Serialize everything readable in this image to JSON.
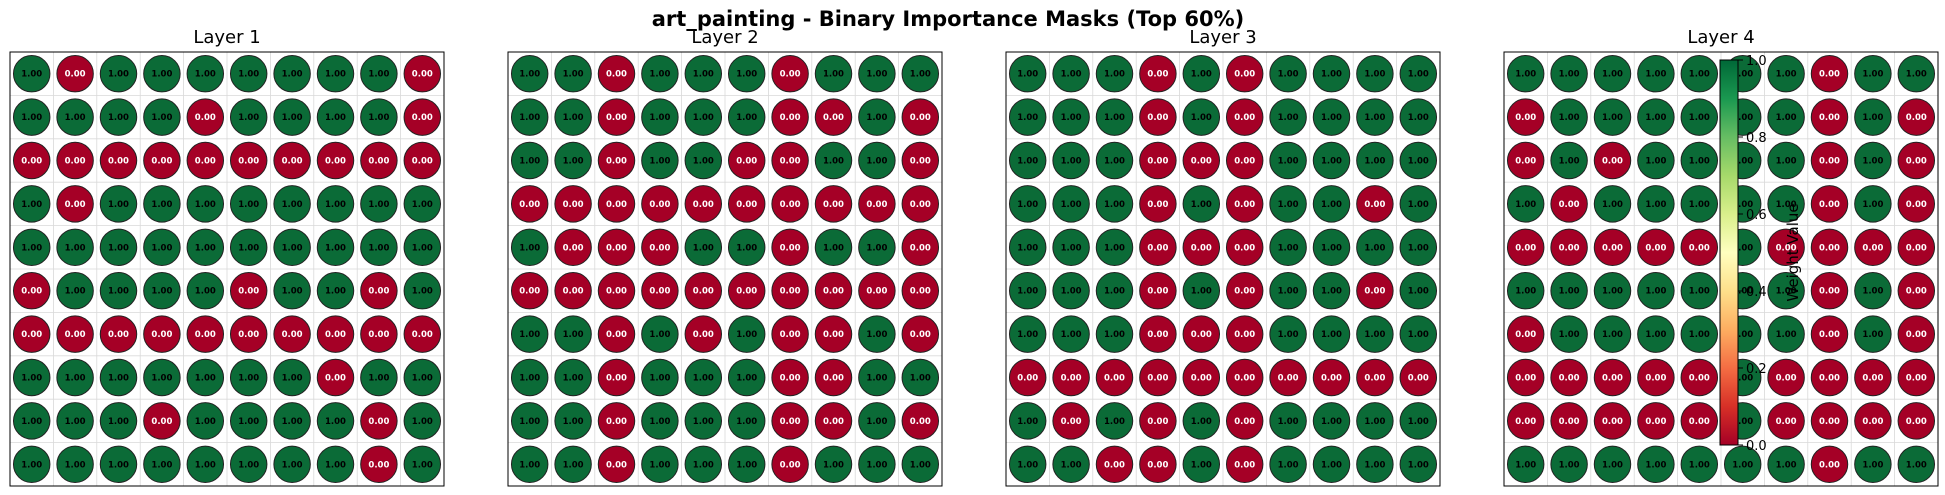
{
  "figure": {
    "title": "art_painting - Binary Importance Masks (Top 60%)"
  },
  "colorbar": {
    "label": "Weight Value",
    "ticks": [
      "0.0",
      "0.2",
      "0.4",
      "0.6",
      "0.8",
      "1.0"
    ],
    "tick_values": [
      0.0,
      0.2,
      0.4,
      0.6,
      0.8,
      1.0
    ],
    "colormap": "RdYlGn",
    "low_color": "#a50026",
    "mid_color": "#ffffbf",
    "high_color": "#006837"
  },
  "colors": {
    "on": "#0b6b37",
    "off": "#a50026",
    "cell_border": "#222222",
    "grid": "#d9d9d9"
  },
  "chart_data": [
    {
      "type": "heatmap",
      "title": "Layer 1",
      "rows": 10,
      "cols": 10,
      "value_format": "0.00",
      "values": [
        [
          1,
          0,
          1,
          1,
          1,
          1,
          1,
          1,
          1,
          0
        ],
        [
          1,
          1,
          1,
          1,
          0,
          1,
          1,
          1,
          1,
          0
        ],
        [
          0,
          0,
          0,
          0,
          0,
          0,
          0,
          0,
          0,
          0
        ],
        [
          1,
          0,
          1,
          1,
          1,
          1,
          1,
          1,
          1,
          1
        ],
        [
          1,
          1,
          1,
          1,
          1,
          1,
          1,
          1,
          1,
          1
        ],
        [
          0,
          1,
          1,
          1,
          1,
          0,
          1,
          1,
          0,
          1
        ],
        [
          0,
          0,
          0,
          0,
          0,
          0,
          0,
          0,
          0,
          0
        ],
        [
          1,
          1,
          1,
          1,
          1,
          1,
          1,
          0,
          1,
          1
        ],
        [
          1,
          1,
          1,
          0,
          1,
          1,
          1,
          1,
          0,
          1
        ],
        [
          1,
          1,
          1,
          1,
          1,
          1,
          1,
          1,
          0,
          1
        ]
      ]
    },
    {
      "type": "heatmap",
      "title": "Layer 2",
      "rows": 10,
      "cols": 10,
      "value_format": "0.00",
      "values": [
        [
          1,
          1,
          0,
          1,
          1,
          1,
          0,
          1,
          1,
          1
        ],
        [
          1,
          1,
          0,
          1,
          1,
          1,
          0,
          0,
          1,
          0
        ],
        [
          1,
          1,
          0,
          1,
          1,
          0,
          0,
          1,
          1,
          0
        ],
        [
          0,
          0,
          0,
          0,
          0,
          0,
          0,
          0,
          0,
          0
        ],
        [
          1,
          0,
          0,
          0,
          1,
          1,
          0,
          1,
          1,
          0
        ],
        [
          0,
          0,
          0,
          0,
          0,
          0,
          0,
          0,
          0,
          0
        ],
        [
          1,
          1,
          0,
          1,
          0,
          1,
          0,
          0,
          1,
          0
        ],
        [
          1,
          1,
          0,
          1,
          1,
          1,
          0,
          0,
          1,
          1
        ],
        [
          1,
          1,
          0,
          1,
          1,
          1,
          0,
          0,
          1,
          0
        ],
        [
          1,
          1,
          0,
          1,
          1,
          1,
          0,
          1,
          1,
          1
        ]
      ]
    },
    {
      "type": "heatmap",
      "title": "Layer 3",
      "rows": 10,
      "cols": 10,
      "value_format": "0.00",
      "values": [
        [
          1,
          1,
          1,
          0,
          1,
          0,
          1,
          1,
          1,
          1
        ],
        [
          1,
          1,
          1,
          0,
          1,
          0,
          1,
          1,
          1,
          1
        ],
        [
          1,
          1,
          1,
          0,
          0,
          0,
          1,
          1,
          1,
          1
        ],
        [
          1,
          1,
          1,
          0,
          1,
          0,
          1,
          1,
          0,
          1
        ],
        [
          1,
          1,
          1,
          0,
          0,
          0,
          1,
          1,
          1,
          1
        ],
        [
          1,
          1,
          1,
          0,
          1,
          0,
          1,
          1,
          0,
          1
        ],
        [
          1,
          1,
          1,
          0,
          0,
          0,
          1,
          1,
          1,
          1
        ],
        [
          0,
          0,
          0,
          0,
          0,
          0,
          0,
          0,
          0,
          0
        ],
        [
          1,
          0,
          1,
          0,
          1,
          0,
          1,
          1,
          1,
          1
        ],
        [
          1,
          1,
          0,
          0,
          1,
          0,
          1,
          1,
          1,
          1
        ]
      ]
    },
    {
      "type": "heatmap",
      "title": "Layer 4",
      "rows": 10,
      "cols": 10,
      "value_format": "0.00",
      "values": [
        [
          1,
          1,
          1,
          1,
          1,
          1,
          1,
          0,
          1,
          1
        ],
        [
          0,
          1,
          1,
          1,
          1,
          1,
          1,
          0,
          1,
          0
        ],
        [
          0,
          1,
          0,
          1,
          1,
          1,
          1,
          0,
          1,
          0
        ],
        [
          1,
          0,
          1,
          1,
          1,
          1,
          1,
          0,
          1,
          0
        ],
        [
          0,
          0,
          0,
          0,
          0,
          1,
          0,
          0,
          0,
          0
        ],
        [
          1,
          1,
          1,
          1,
          1,
          1,
          1,
          0,
          1,
          0
        ],
        [
          0,
          1,
          1,
          1,
          1,
          1,
          1,
          0,
          1,
          0
        ],
        [
          0,
          0,
          0,
          0,
          0,
          1,
          0,
          0,
          0,
          0
        ],
        [
          0,
          0,
          0,
          0,
          0,
          1,
          0,
          0,
          0,
          0
        ],
        [
          1,
          1,
          1,
          1,
          1,
          1,
          1,
          0,
          1,
          1
        ]
      ]
    }
  ]
}
